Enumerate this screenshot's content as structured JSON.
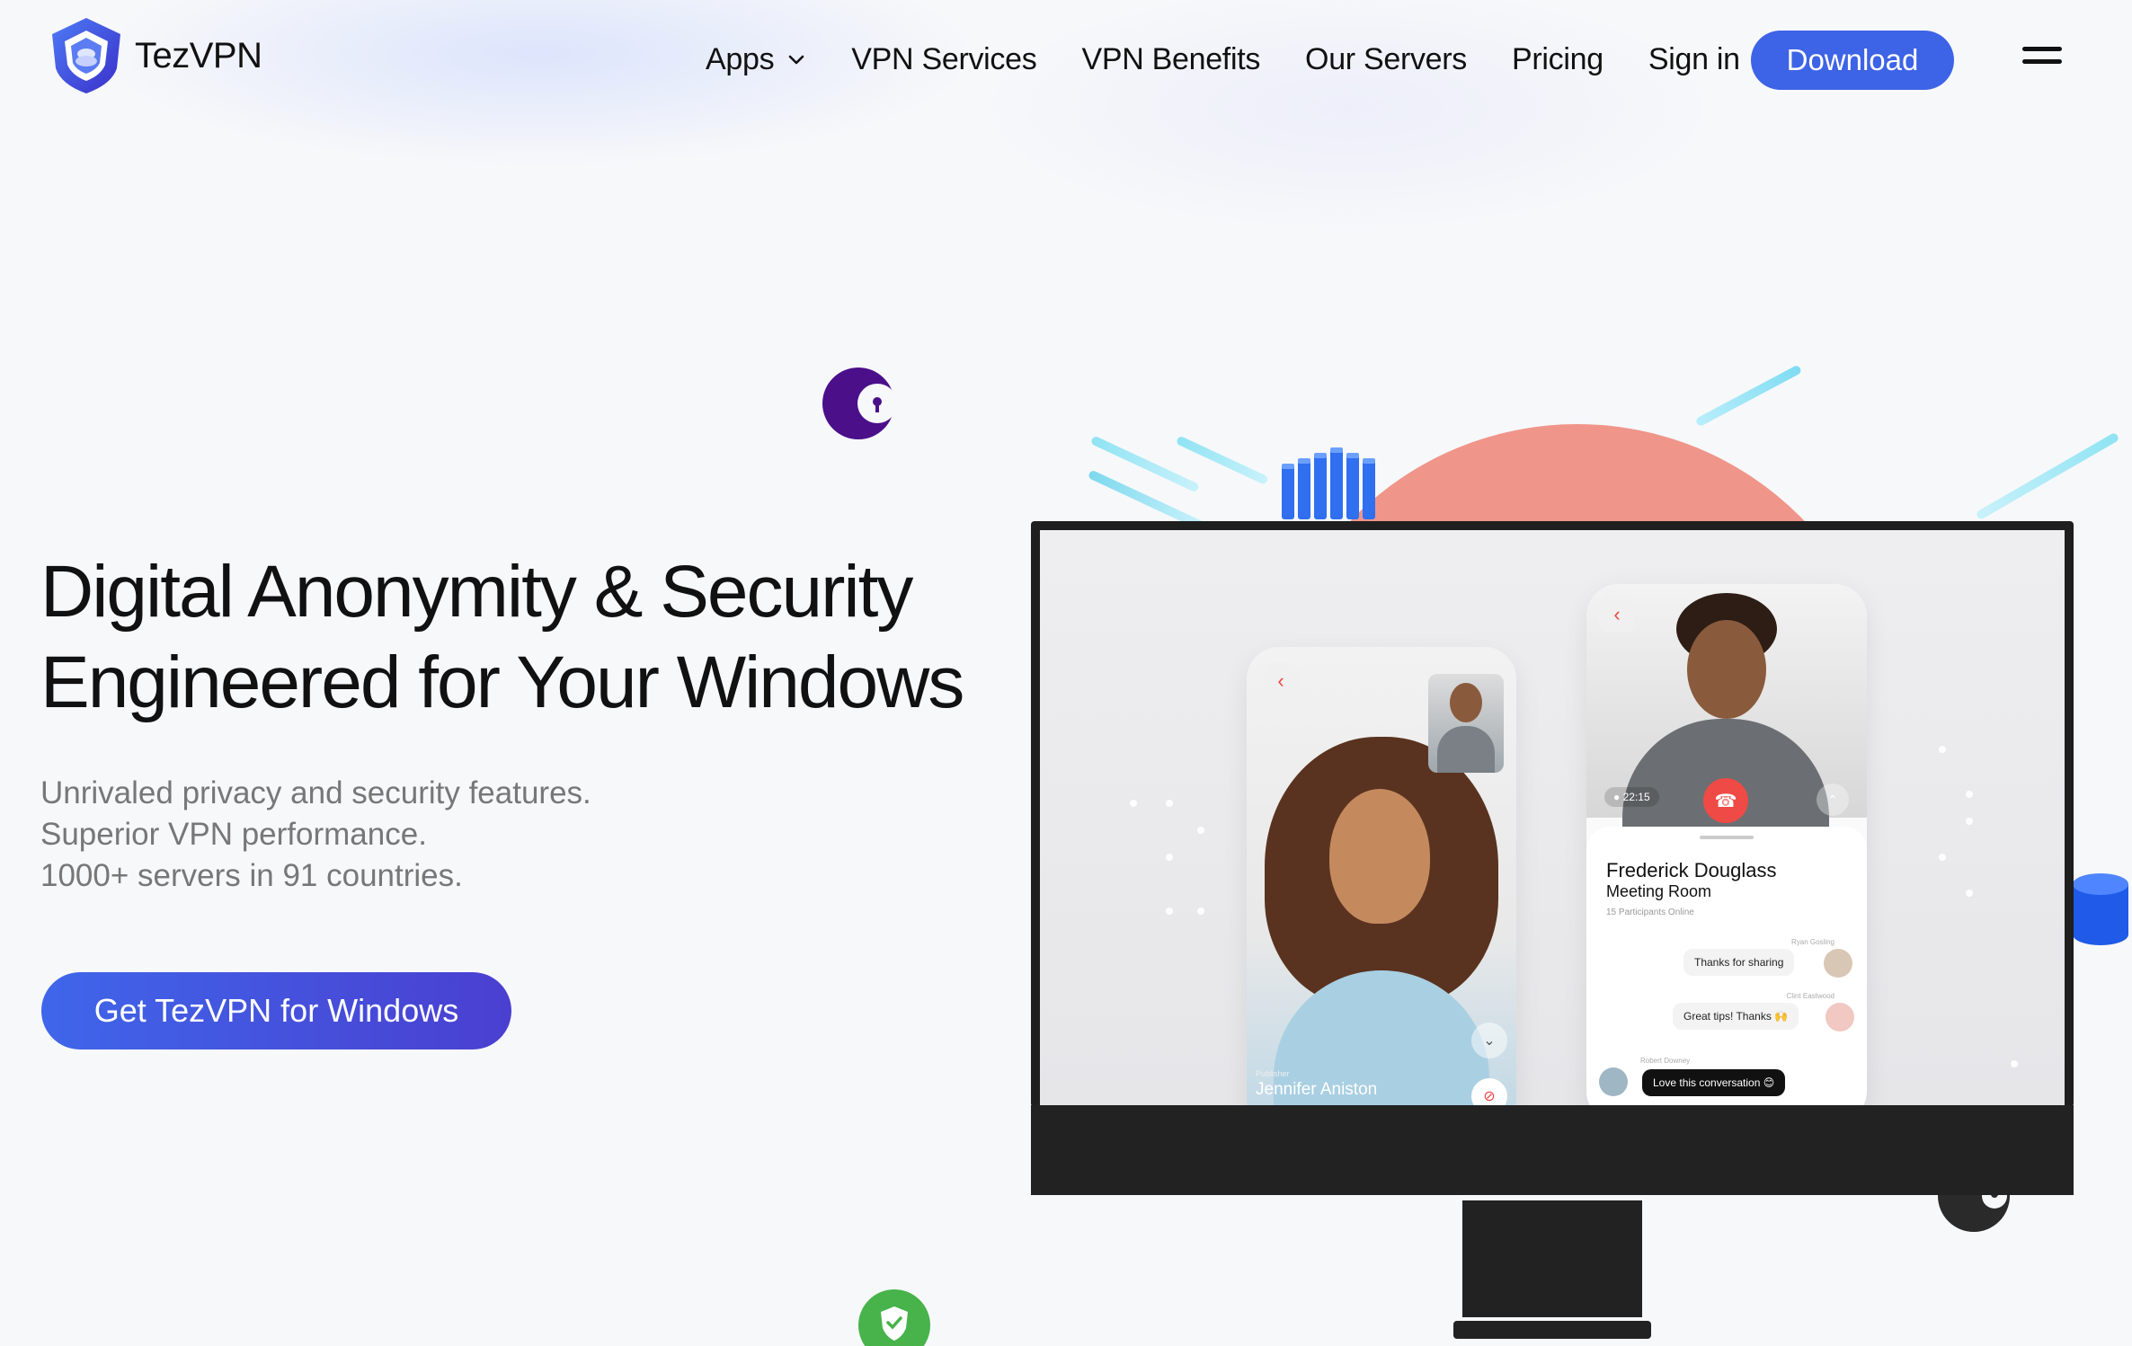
{
  "brand": {
    "name": "TezVPN",
    "accent": "#3d63e6",
    "logo_icon": "tezvpn-shield-logo"
  },
  "nav": {
    "items": [
      {
        "label": "Apps",
        "has_dropdown": true
      },
      {
        "label": "VPN Services"
      },
      {
        "label": "VPN Benefits"
      },
      {
        "label": "Our Servers"
      },
      {
        "label": "Pricing"
      },
      {
        "label": "Sign in"
      }
    ],
    "download_label": "Download",
    "menu_icon": "hamburger-menu-icon"
  },
  "hero": {
    "title_line1": "Digital Anonymity & Security",
    "title_line2": "Engineered for Your Windows",
    "sub_line1": "Unrivaled privacy and security features.",
    "sub_line2": "Superior VPN performance.",
    "sub_line3": "1000+ servers in 91 countries.",
    "cta_label": "Get TezVPN for Windows"
  },
  "illustration": {
    "call_screen": {
      "publisher_label": "Publisher",
      "publisher_name": "Jennifer Aniston",
      "timer": "22:15",
      "room_host": "Frederick Douglass",
      "room_name": "Meeting Room",
      "participants": "15 Participants Online",
      "messages": [
        {
          "author": "Ryan Gosling",
          "text": "Thanks for sharing"
        },
        {
          "author": "Clint Eastwood",
          "text": "Great tips! Thanks 🙌"
        },
        {
          "author": "Robert Downey",
          "text": "Love this conversation 😊"
        }
      ]
    },
    "colors": {
      "orange_circle": "#f0958a",
      "call_red": "#ef4a45",
      "purple_moon": "#4b0f8a",
      "green_shield": "#47b34a"
    }
  }
}
